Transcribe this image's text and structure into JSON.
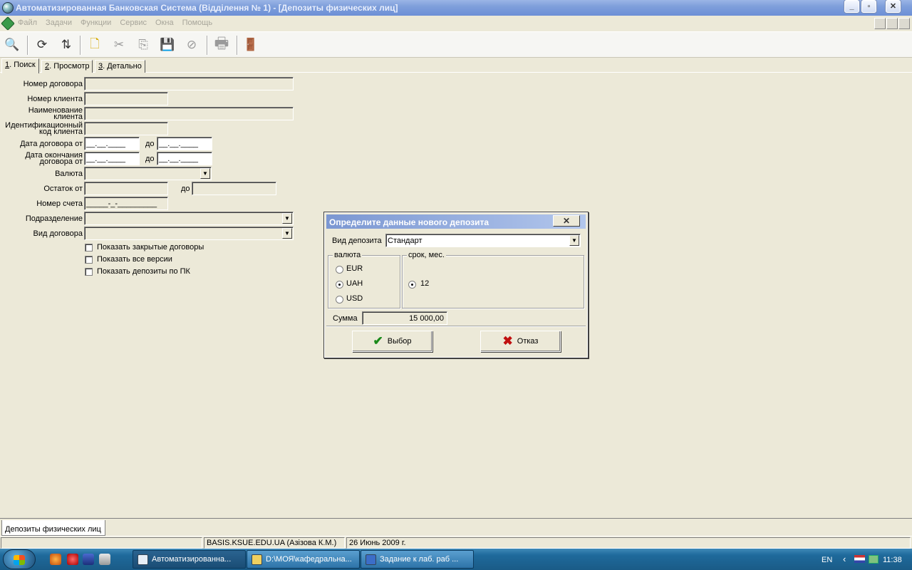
{
  "window": {
    "title": "Автоматизированная Банковская Система (Відділення № 1) - [Депозиты физических лиц]",
    "controls": [
      "_",
      "▫",
      "✕"
    ]
  },
  "menu": {
    "items": [
      "Файл",
      "Задачи",
      "Функции",
      "Сервис",
      "Окна",
      "Помощь"
    ]
  },
  "toolbar": {
    "buttons": [
      {
        "icon": "magnifier-icon",
        "glyph": "🔍"
      },
      {
        "icon": "refresh-icon",
        "glyph": "⟳"
      },
      {
        "icon": "sort-icon",
        "glyph": "⇅"
      },
      {
        "icon": "new-document-icon",
        "glyph": "🗋"
      },
      {
        "icon": "cut-icon",
        "glyph": "✂"
      },
      {
        "icon": "copy-icon",
        "glyph": "⎘"
      },
      {
        "icon": "save-icon",
        "glyph": "💾"
      },
      {
        "icon": "cancel-icon",
        "glyph": "⊘"
      },
      {
        "icon": "print-icon",
        "glyph": "🖶"
      },
      {
        "icon": "exit-icon",
        "glyph": "🚪"
      }
    ]
  },
  "tabs": [
    {
      "num": "1",
      "label": ". Поиск"
    },
    {
      "num": "2",
      "label": ". Просмотр"
    },
    {
      "num": "3",
      "label": ". Детально"
    }
  ],
  "form": {
    "contract_number_label": "Номер договора",
    "client_number_label": "Номер клиента",
    "client_name_label_1": "Наименование",
    "client_name_label_2": "клиента",
    "client_id_label_1": "Идентификационный",
    "client_id_label_2": "код клиента",
    "contract_date_label": "Дата договора от",
    "end_date_label_1": "Дата окончания",
    "end_date_label_2": "договора от",
    "to_label": "до",
    "date_mask": "__.__.____",
    "currency_label": "Валюта",
    "balance_label": "Остаток от",
    "account_label": "Номер счета",
    "account_mask": "_____-_-_________",
    "department_label": "Подразделение",
    "contract_type_label": "Вид договора",
    "checkboxes": [
      "Показать закрытые договоры",
      "Показать все версии",
      "Показать депозиты по ПК"
    ]
  },
  "dialog": {
    "title": "Определите данные нового депозита",
    "close": "✕",
    "deposit_type_label": "Вид депозита",
    "deposit_type_value": "Стандарт",
    "currency_group": "валюта",
    "currencies": [
      {
        "label": "EUR",
        "selected": false
      },
      {
        "label": "UAH",
        "selected": true
      },
      {
        "label": "USD",
        "selected": false
      }
    ],
    "term_group": "срок, мес.",
    "terms": [
      {
        "label": "12",
        "selected": true
      }
    ],
    "amount_label": "Сумма",
    "amount_value": "15 000,00",
    "ok_label": "Выбор",
    "cancel_label": "Отказ"
  },
  "doc_tab": "Депозиты физических лиц",
  "status": {
    "user": "BASIS.KSUE.EDU.UA (Азізова К.М.)",
    "date": "26 Июнь 2009 г."
  },
  "taskbar": {
    "tasks": [
      "Автоматизированна...",
      "D:\\МОЯ\\кафедральна...",
      "Задание к лаб. раб ..."
    ],
    "lang": "EN",
    "time": "11:38"
  },
  "colors": {
    "titlebar": "#7f9fdb",
    "dialog_title": "#7b97d2",
    "taskbar": "#1f6a9c",
    "ok_check": "#1a8a1a",
    "cancel_x": "#c01010"
  }
}
